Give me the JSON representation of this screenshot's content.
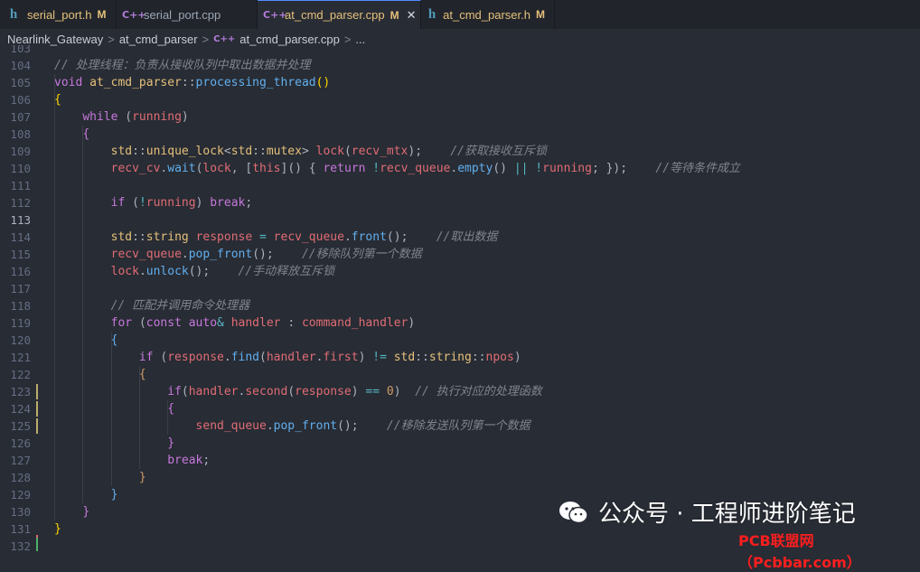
{
  "tabs": [
    {
      "icon": "h",
      "name": "serial_port.h",
      "mark": "M",
      "active": false
    },
    {
      "icon": "C++",
      "name": "serial_port.cpp",
      "mark": "",
      "active": false
    },
    {
      "icon": "C++",
      "name": "at_cmd_parser.cpp",
      "mark": "M",
      "active": true,
      "close": "✕"
    },
    {
      "icon": "h",
      "name": "at_cmd_parser.h",
      "mark": "M",
      "active": false
    }
  ],
  "breadcrumb": {
    "items": [
      "Nearlink_Gateway",
      "at_cmd_parser",
      "at_cmd_parser.cpp",
      "..."
    ],
    "separator": ">",
    "file_icon": "C++"
  },
  "editor": {
    "current_line": 113,
    "lines": [
      {
        "num": "103",
        "tokens": []
      },
      {
        "num": "104",
        "tokens": [
          [
            "c",
            "// 处理线程：负责从接收队列中取出数据并处理"
          ]
        ]
      },
      {
        "num": "105",
        "tokens": [
          [
            "k",
            "void "
          ],
          [
            "t",
            "at_cmd_parser"
          ],
          [
            "p",
            "::"
          ],
          [
            "f",
            "processing_thread"
          ],
          [
            "b",
            "()"
          ]
        ]
      },
      {
        "num": "106",
        "tokens": [
          [
            "b",
            "{"
          ]
        ]
      },
      {
        "num": "107",
        "tokens": [
          [
            "p",
            "    "
          ],
          [
            "k",
            "while "
          ],
          [
            "p",
            "("
          ],
          [
            "v",
            "running"
          ],
          [
            "p",
            ")"
          ]
        ]
      },
      {
        "num": "108",
        "tokens": [
          [
            "p",
            "    "
          ],
          [
            "k",
            "{"
          ]
        ]
      },
      {
        "num": "109",
        "tokens": [
          [
            "p",
            "        "
          ],
          [
            "t",
            "std"
          ],
          [
            "p",
            "::"
          ],
          [
            "t",
            "unique_lock"
          ],
          [
            "p",
            "<"
          ],
          [
            "t",
            "std"
          ],
          [
            "p",
            "::"
          ],
          [
            "t",
            "mutex"
          ],
          [
            "p",
            "> "
          ],
          [
            "v",
            "lock"
          ],
          [
            "p",
            "("
          ],
          [
            "v",
            "recv_mtx"
          ],
          [
            "p",
            ");    "
          ],
          [
            "c",
            "//获取接收互斥锁"
          ]
        ]
      },
      {
        "num": "110",
        "tokens": [
          [
            "p",
            "        "
          ],
          [
            "v",
            "recv_cv"
          ],
          [
            "p",
            "."
          ],
          [
            "f",
            "wait"
          ],
          [
            "p",
            "("
          ],
          [
            "v",
            "lock"
          ],
          [
            "p",
            ", ["
          ],
          [
            "v",
            "this"
          ],
          [
            "p",
            "]() { "
          ],
          [
            "k",
            "return "
          ],
          [
            "o",
            "!"
          ],
          [
            "v",
            "recv_queue"
          ],
          [
            "p",
            "."
          ],
          [
            "f",
            "empty"
          ],
          [
            "p",
            "() "
          ],
          [
            "o",
            "|| !"
          ],
          [
            "v",
            "running"
          ],
          [
            "p",
            "; });    "
          ],
          [
            "c",
            "//等待条件成立"
          ]
        ]
      },
      {
        "num": "111",
        "tokens": []
      },
      {
        "num": "112",
        "tokens": [
          [
            "p",
            "        "
          ],
          [
            "k",
            "if "
          ],
          [
            "p",
            "("
          ],
          [
            "o",
            "!"
          ],
          [
            "v",
            "running"
          ],
          [
            "p",
            ") "
          ],
          [
            "k",
            "break"
          ],
          [
            "p",
            ";"
          ]
        ]
      },
      {
        "num": "113",
        "tokens": []
      },
      {
        "num": "114",
        "tokens": [
          [
            "p",
            "        "
          ],
          [
            "t",
            "std"
          ],
          [
            "p",
            "::"
          ],
          [
            "t",
            "string "
          ],
          [
            "v",
            "response "
          ],
          [
            "o",
            "= "
          ],
          [
            "v",
            "recv_queue"
          ],
          [
            "p",
            "."
          ],
          [
            "f",
            "front"
          ],
          [
            "p",
            "();    "
          ],
          [
            "c",
            "//取出数据"
          ]
        ]
      },
      {
        "num": "115",
        "tokens": [
          [
            "p",
            "        "
          ],
          [
            "v",
            "recv_queue"
          ],
          [
            "p",
            "."
          ],
          [
            "f",
            "pop_front"
          ],
          [
            "p",
            "();    "
          ],
          [
            "c",
            "//移除队列第一个数据"
          ]
        ]
      },
      {
        "num": "116",
        "tokens": [
          [
            "p",
            "        "
          ],
          [
            "v",
            "lock"
          ],
          [
            "p",
            "."
          ],
          [
            "f",
            "unlock"
          ],
          [
            "p",
            "();    "
          ],
          [
            "c",
            "//手动释放互斥锁"
          ]
        ]
      },
      {
        "num": "117",
        "tokens": []
      },
      {
        "num": "118",
        "tokens": [
          [
            "p",
            "        "
          ],
          [
            "c",
            "// 匹配并调用命令处理器"
          ]
        ]
      },
      {
        "num": "119",
        "tokens": [
          [
            "p",
            "        "
          ],
          [
            "k",
            "for "
          ],
          [
            "p",
            "("
          ],
          [
            "k",
            "const auto"
          ],
          [
            "o",
            "& "
          ],
          [
            "v",
            "handler "
          ],
          [
            "p",
            ": "
          ],
          [
            "v",
            "command_handler"
          ],
          [
            "p",
            ")"
          ]
        ]
      },
      {
        "num": "120",
        "tokens": [
          [
            "p",
            "        "
          ],
          [
            "f",
            "{"
          ]
        ]
      },
      {
        "num": "121",
        "tokens": [
          [
            "p",
            "            "
          ],
          [
            "k",
            "if "
          ],
          [
            "p",
            "("
          ],
          [
            "v",
            "response"
          ],
          [
            "p",
            "."
          ],
          [
            "f",
            "find"
          ],
          [
            "p",
            "("
          ],
          [
            "v",
            "handler"
          ],
          [
            "p",
            "."
          ],
          [
            "v",
            "first"
          ],
          [
            "p",
            ") "
          ],
          [
            "o",
            "!= "
          ],
          [
            "t",
            "std"
          ],
          [
            "p",
            "::"
          ],
          [
            "t",
            "string"
          ],
          [
            "p",
            "::"
          ],
          [
            "v",
            "npos"
          ],
          [
            "p",
            ")"
          ]
        ]
      },
      {
        "num": "122",
        "tokens": [
          [
            "p",
            "            "
          ],
          [
            "n",
            "{"
          ]
        ]
      },
      {
        "num": "123",
        "tokens": [
          [
            "p",
            "                "
          ],
          [
            "k",
            "if"
          ],
          [
            "p",
            "("
          ],
          [
            "v",
            "handler"
          ],
          [
            "p",
            "."
          ],
          [
            "v",
            "second"
          ],
          [
            "p",
            "("
          ],
          [
            "v",
            "response"
          ],
          [
            "p",
            ") "
          ],
          [
            "o",
            "== "
          ],
          [
            "n",
            "0"
          ],
          [
            "p",
            ")  "
          ],
          [
            "c",
            "// 执行对应的处理函数"
          ]
        ]
      },
      {
        "num": "124",
        "tokens": [
          [
            "p",
            "                "
          ],
          [
            "k",
            "{"
          ]
        ]
      },
      {
        "num": "125",
        "tokens": [
          [
            "p",
            "                    "
          ],
          [
            "v",
            "send_queue"
          ],
          [
            "p",
            "."
          ],
          [
            "f",
            "pop_front"
          ],
          [
            "p",
            "();    "
          ],
          [
            "c",
            "//移除发送队列第一个数据"
          ]
        ]
      },
      {
        "num": "126",
        "tokens": [
          [
            "p",
            "                "
          ],
          [
            "k",
            "}"
          ]
        ]
      },
      {
        "num": "127",
        "tokens": [
          [
            "p",
            "                "
          ],
          [
            "k",
            "break"
          ],
          [
            "p",
            ";"
          ]
        ]
      },
      {
        "num": "128",
        "tokens": [
          [
            "p",
            "            "
          ],
          [
            "n",
            "}"
          ]
        ]
      },
      {
        "num": "129",
        "tokens": [
          [
            "p",
            "        "
          ],
          [
            "f",
            "}"
          ]
        ]
      },
      {
        "num": "130",
        "tokens": [
          [
            "p",
            "    "
          ],
          [
            "k",
            "}"
          ]
        ]
      },
      {
        "num": "131",
        "tokens": [
          [
            "b",
            "}"
          ]
        ]
      },
      {
        "num": "132",
        "tokens": []
      }
    ]
  },
  "watermark": {
    "text": "公众号 · 工程师进阶笔记",
    "site": "PCB联盟网（Pcbbar.com）"
  },
  "colors": {
    "background": "#282c34",
    "tabbar": "#21252b",
    "comment": "#7f848e",
    "keyword": "#c678dd",
    "type": "#e5c07b",
    "function": "#61afef",
    "variable": "#e06c75"
  }
}
